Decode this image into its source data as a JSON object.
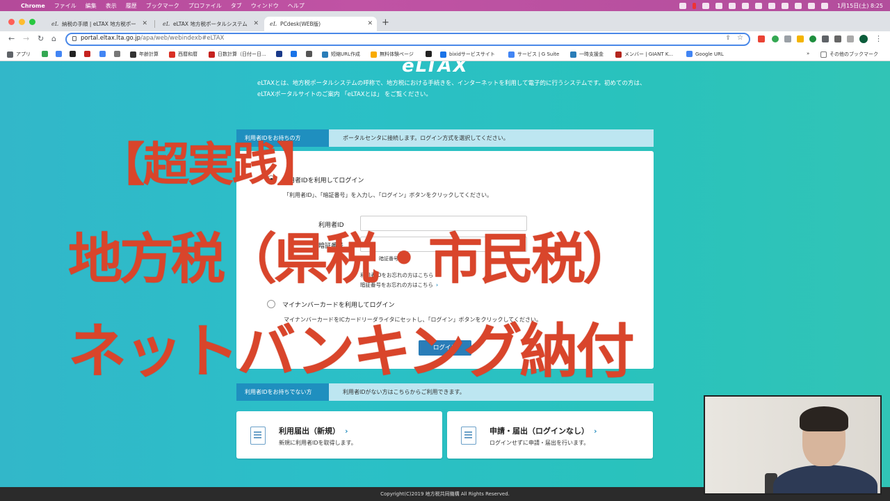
{
  "menubar": {
    "items": [
      "Chrome",
      "ファイル",
      "編集",
      "表示",
      "履歴",
      "ブックマーク",
      "プロファイル",
      "タブ",
      "ウィンドウ",
      "ヘルプ"
    ],
    "clock": "1月15日(土) 8:25"
  },
  "tabs": [
    {
      "label": "納税の手順 | eLTAX 地方税ポー"
    },
    {
      "label": "eLTAX 地方税ポータルシステム"
    },
    {
      "label": "PCdesk(WEB版)"
    }
  ],
  "toolbar": {
    "url_host": "portal.eltax.lta.go.jp",
    "url_path": "/apa/web/webindexb#eLTAX"
  },
  "bookmarks": [
    {
      "label": "アプリ",
      "color": "#5f6368"
    },
    {
      "label": "",
      "color": "#34a853"
    },
    {
      "label": "",
      "color": "#4285f4"
    },
    {
      "label": "",
      "color": "#222222"
    },
    {
      "label": "",
      "color": "#c5221f"
    },
    {
      "label": "",
      "color": "#4285f4"
    },
    {
      "label": "年齢計算",
      "color": "#333333"
    },
    {
      "label": "西暦和暦",
      "color": "#d93025"
    },
    {
      "label": "日数計算（日付ー日...",
      "color": "#c5221f"
    },
    {
      "label": "",
      "color": "#1a3a8a"
    },
    {
      "label": "",
      "color": "#1a73e8"
    },
    {
      "label": "",
      "color": "#555555"
    },
    {
      "label": "短縮URL作成",
      "color": "#2a7db8"
    },
    {
      "label": "無料体験ページ",
      "color": "#f9ab00"
    },
    {
      "label": "",
      "color": "#222222"
    },
    {
      "label": "bixidサービスサイト",
      "color": "#1a73e8"
    },
    {
      "label": "サービス | G Suite",
      "color": "#4285f4"
    },
    {
      "label": "一時支援金",
      "color": "#2a7db8"
    },
    {
      "label": "メンバー | GIANT K...",
      "color": "#b3261e"
    },
    {
      "label": "Google URL",
      "color": "#4285f4"
    }
  ],
  "bookmarks_more": "»",
  "bookmarks_other": "その他のブックマーク",
  "page": {
    "logo": "eLTAX",
    "intro": "eLTAXとは、地方税ポータルシステムの呼称で、地方税における手続きを、インターネットを利用して電子的に行うシステムです。初めての方は、eLTAXポータルサイトのご案内 「eLTAXとは」 をご覧ください。",
    "section1_label": "利用者IDをお持ちの方",
    "section1_msg": "ポータルセンタに接続します。ログイン方式を選択してください。",
    "opt1_label": "利用者IDを利用してログイン",
    "opt1_desc": "「利用者ID」、「暗証番号」を入力し、「ログイン」ボタンをクリックしてください。",
    "userid_label": "利用者ID",
    "pin_label": "暗証番号",
    "pin_hint": "暗証番号",
    "link_forgot_id": "利用者IDをお忘れの方はこちら",
    "link_forgot_pin": "暗証番号をお忘れの方はこちら",
    "opt2_label": "マイナンバーカードを利用してログイン",
    "opt2_desc": "マイナンバーカードをICカードリーダライタにセットし、「ログイン」ボタンをクリックしてください。",
    "login_button": "ログイン",
    "section2_label": "利用者IDをお持ちでない方",
    "section2_msg": "利用者IDがない方はこちらからご利用できます。",
    "card1_title": "利用届出（新規）",
    "card1_sub": "新規に利用者IDを取得します。",
    "card2_title": "申請・届出（ログインなし）",
    "card2_sub": "ログインせずに申請・届出を行います。",
    "footer": "Copyright(C)2019 地方税共同機構 All Rights Reserved."
  },
  "overlay": {
    "line1": "【超実践】",
    "line2": "地方税（県税・市民税）",
    "line3": "ネットバンキング納付"
  }
}
